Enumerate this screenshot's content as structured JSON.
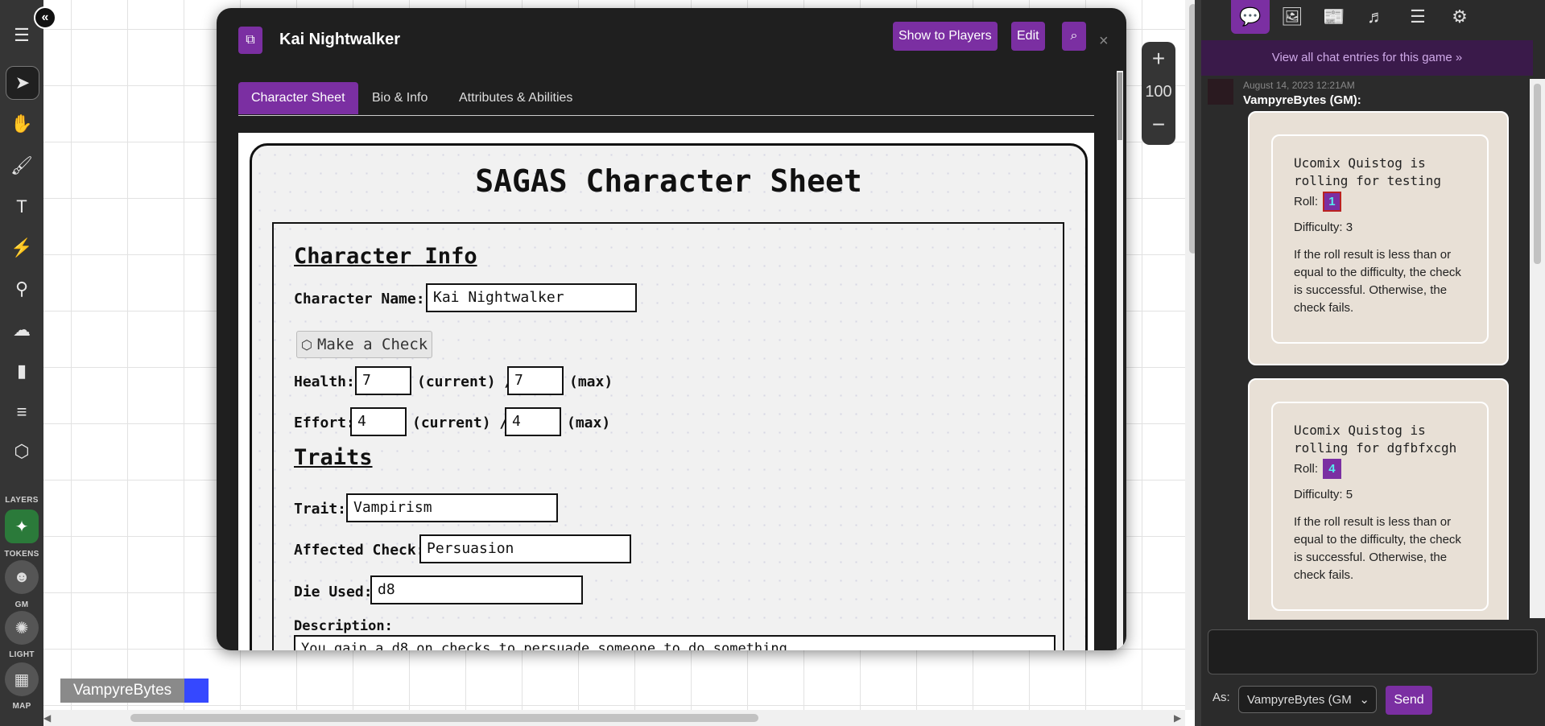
{
  "player": {
    "name": "VampyreBytes",
    "color": "#3548ff"
  },
  "zoom": {
    "value": "100",
    "plus": "+",
    "minus": "−"
  },
  "toolbar": {
    "layers_label": "LAYERS",
    "tokens_label": "TOKENS",
    "gm_label": "GM",
    "light_label": "LIGHT",
    "map_label": "MAP"
  },
  "dialog": {
    "title": "Kai Nightwalker",
    "show_players": "Show to Players",
    "edit": "Edit",
    "close": "×",
    "tabs": [
      "Character Sheet",
      "Bio & Info",
      "Attributes & Abilities"
    ]
  },
  "sheet": {
    "title": "SAGAS Character Sheet",
    "char_info_heading": "Character Info",
    "char_name_label": "Character Name:",
    "char_name_value": "Kai Nightwalker",
    "make_check": "Make a Check",
    "health_label": "Health:",
    "health_current": "7",
    "health_max": "7",
    "current_label": "(current) /",
    "max_label": "(max)",
    "effort_label": "Effort:",
    "effort_current": "4",
    "effort_max": "4",
    "traits_heading": "Traits",
    "trait_label": "Trait:",
    "trait_value": "Vampirism",
    "affected_label": "Affected Check:",
    "affected_value": "Persuasion",
    "die_label": "Die Used:",
    "die_value": "d8",
    "description_label": "Description:",
    "description_value": "You gain a d8 on checks to persuade someone to do something."
  },
  "chat": {
    "view_all": "View all chat entries for this game »",
    "time": "August 14, 2023 12:21AM",
    "by": "VampyreBytes (GM):",
    "messages": [
      {
        "title": "Ucomix Quistog is rolling for testing",
        "roll_label": "Roll:",
        "roll": "1",
        "difficulty": "Difficulty: 3",
        "text": "If the roll result is less than or equal to the difficulty, the check is successful. Otherwise, the check fails."
      },
      {
        "title": "Ucomix Quistog is rolling for dgfbfxcgh",
        "roll_label": "Roll:",
        "roll": "4",
        "difficulty": "Difficulty: 5",
        "text": "If the roll result is less than or equal to the difficulty, the check is successful. Otherwise, the check fails."
      }
    ],
    "as_label": "As:",
    "as_value": "VampyreBytes (GM",
    "send": "Send"
  },
  "colors": {
    "accent": "#7b2fa2",
    "layer_active": "#2b7a3a"
  }
}
